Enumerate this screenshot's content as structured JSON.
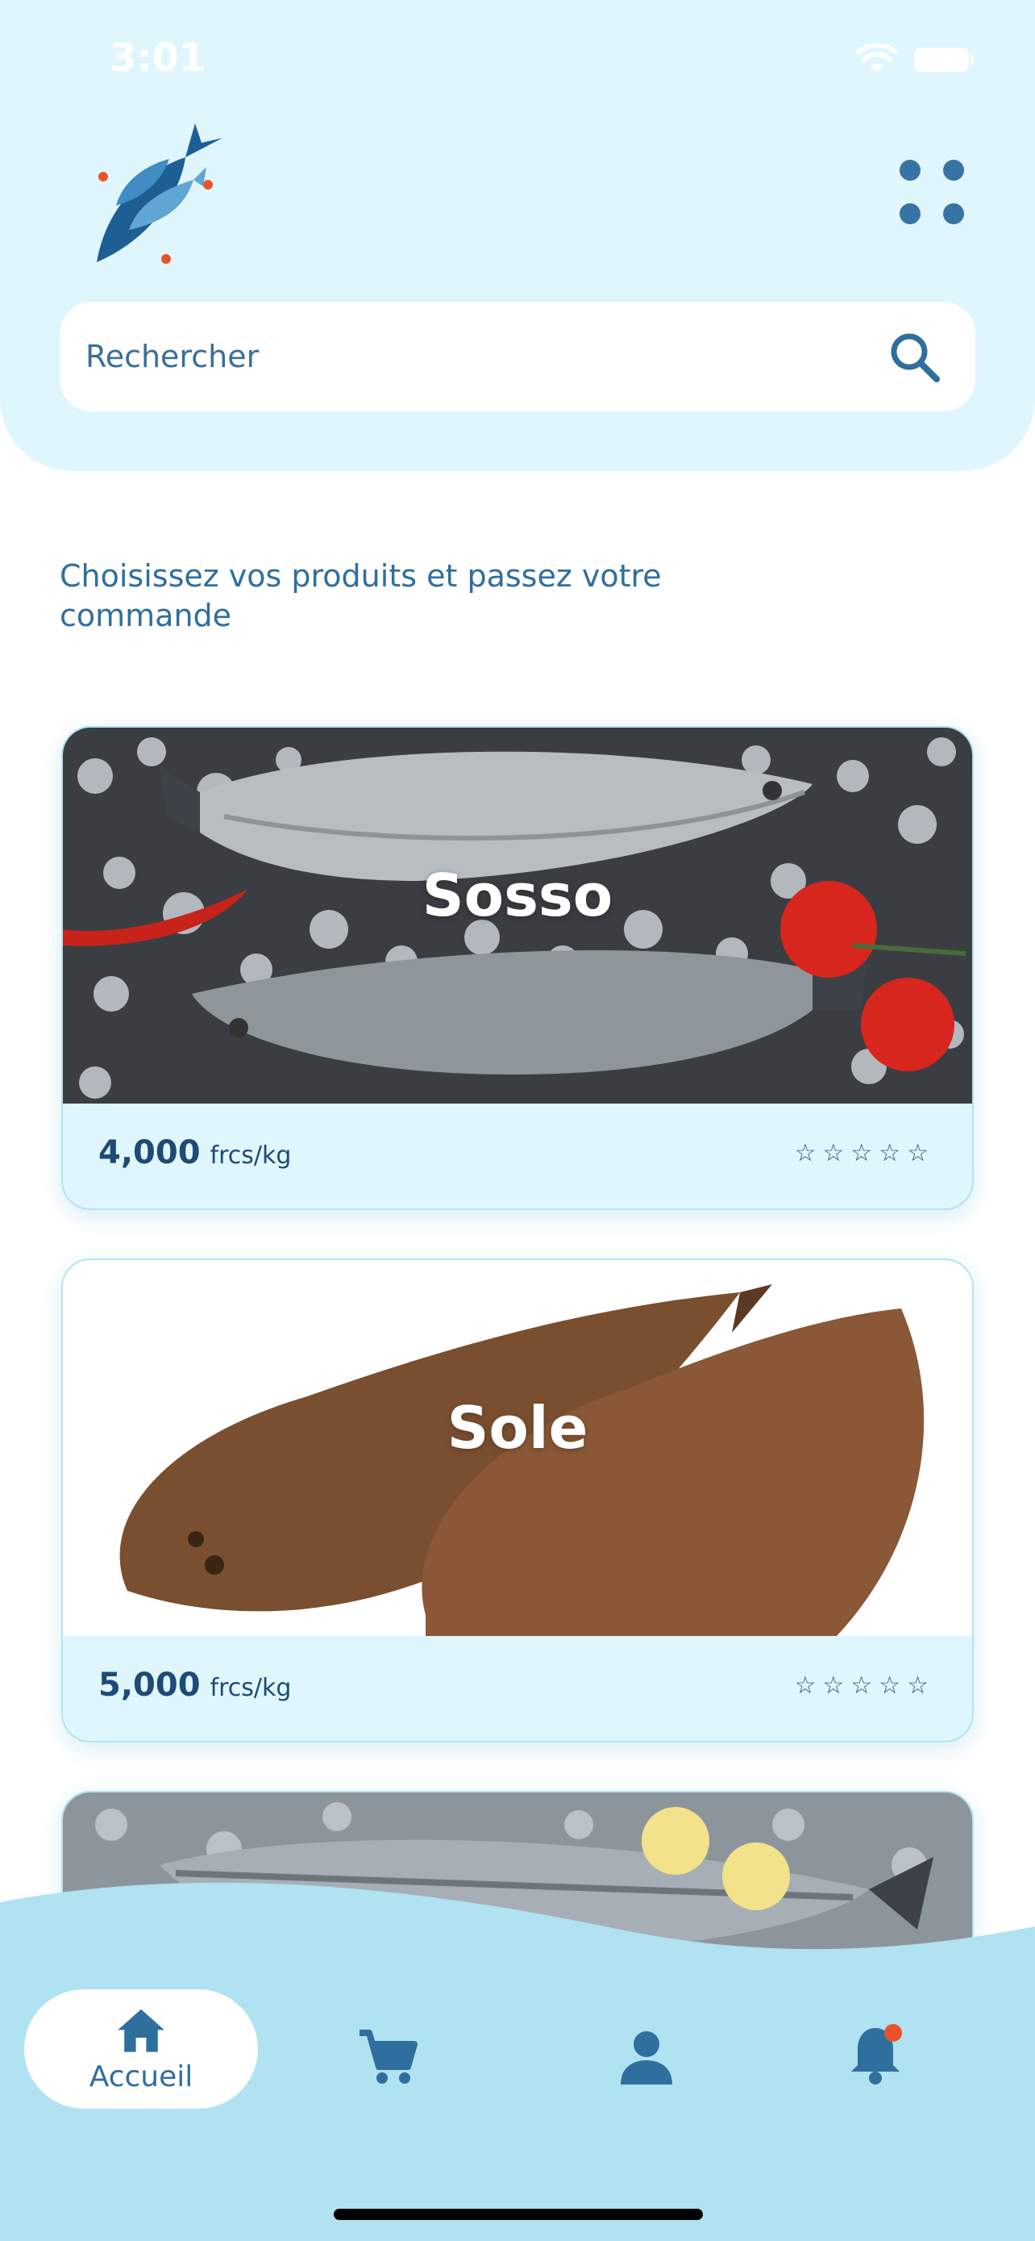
{
  "status_bar": {
    "time": "3:01"
  },
  "search": {
    "placeholder": "Rechercher"
  },
  "intro_text": "Choisissez vos produits et passez votre commande",
  "products": [
    {
      "name": "Sosso",
      "price": "4,000",
      "unit": "frcs/kg",
      "stars": "☆☆☆☆☆",
      "rating": 0
    },
    {
      "name": "Sole",
      "price": "5,000",
      "unit": "frcs/kg",
      "stars": "☆☆☆☆☆",
      "rating": 0
    },
    {
      "name": "",
      "price": "",
      "unit": "",
      "stars": "",
      "rating": 0
    }
  ],
  "nav": {
    "home_label": "Accueil",
    "active": "home",
    "notification_dot": true
  },
  "colors": {
    "header_bg": "#dff6fd",
    "nav_bg": "#b0e2f1",
    "accent": "#3874a3",
    "dark_text": "#1e4a75",
    "notification": "#e8542a"
  },
  "icons": [
    "wifi-icon",
    "battery-icon",
    "fish-logo",
    "menu-dots-icon",
    "search-icon",
    "home-icon",
    "cart-icon",
    "user-icon",
    "bell-icon"
  ]
}
